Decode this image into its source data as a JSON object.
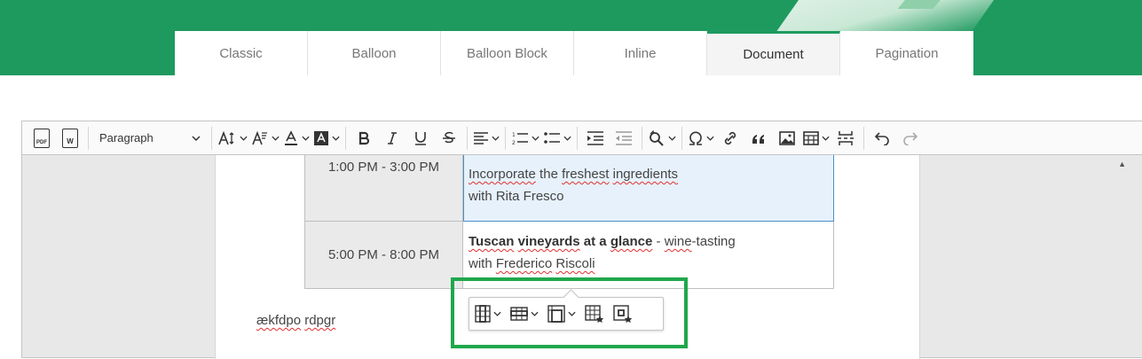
{
  "tabs": [
    {
      "label": "Classic"
    },
    {
      "label": "Balloon"
    },
    {
      "label": "Balloon Block"
    },
    {
      "label": "Inline"
    },
    {
      "label": "Document",
      "active": true
    },
    {
      "label": "Pagination"
    }
  ],
  "toolbar": {
    "pdf_badge": "PDF",
    "word_badge": "W",
    "heading": "Paragraph"
  },
  "table": {
    "rows": [
      {
        "time": "1:00 PM - 3:00 PM",
        "line1_a": "Incorporate",
        "line1_b": " the ",
        "line1_c": "freshest",
        "line1_d": " ",
        "line1_e": "ingredients",
        "line2_a": "with Rita Fresco"
      },
      {
        "time": "5:00 PM - 8:00 PM",
        "bold_1": "Tuscan",
        "bold_2": " ",
        "bold_3": "vineyards",
        "bold_4": " at a ",
        "bold_5": "glance",
        "rest_1": " - ",
        "rest_2": "wine",
        "rest_3": "-tasting",
        "line2_a": "with ",
        "line2_b": "Frederico",
        "line2_c": " ",
        "line2_d": "Riscoli"
      }
    ]
  },
  "paragraph": {
    "word1": "ækfdpo",
    "space": " ",
    "word2": "rdpgr"
  },
  "colors": {
    "brand_green": "#1e9a5f",
    "highlight_box": "#1fa84c",
    "selection_bg": "#e6f1fb"
  }
}
